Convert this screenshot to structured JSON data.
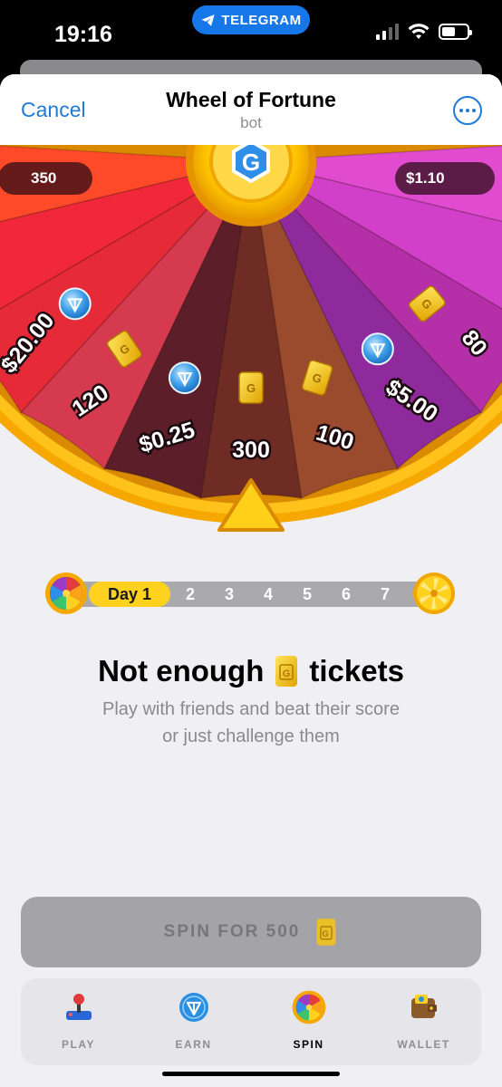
{
  "status_bar": {
    "time": "19:16",
    "pill_label": "TELEGRAM"
  },
  "nav": {
    "cancel_label": "Cancel",
    "title": "Wheel of Fortune",
    "subtitle": "bot",
    "more_icon": "more-dots-icon"
  },
  "wheel": {
    "center_logo": "G",
    "top_left_badge": "350",
    "top_right_badge": "$1.10",
    "segments": [
      {
        "label": "80",
        "reward": "ticket",
        "color": "#b42fa8"
      },
      {
        "label": "$5.00",
        "reward": "ton",
        "color": "#8f2a9c"
      },
      {
        "label": "100",
        "reward": "ticket",
        "color": "#9a4b2e"
      },
      {
        "label": "300",
        "reward": "ticket",
        "color": "#6e2c24"
      },
      {
        "label": "$0.25",
        "reward": "ton",
        "color": "#5c1f2a"
      },
      {
        "label": "120",
        "reward": "ticket",
        "color": "#d63a4f"
      },
      {
        "label": "$20.00",
        "reward": "ton",
        "color": "#e62a38"
      }
    ]
  },
  "streak": {
    "active_label": "Day 1",
    "days": [
      "2",
      "3",
      "4",
      "5",
      "6",
      "7"
    ]
  },
  "message": {
    "title_before": "Not enough",
    "title_after": "tickets",
    "line1": "Play with friends and beat their score",
    "line2": "or just challenge them"
  },
  "spin_button": {
    "label": "SPIN FOR 500"
  },
  "tabs": [
    {
      "label": "PLAY",
      "icon": "joystick-icon",
      "active": false
    },
    {
      "label": "EARN",
      "icon": "ton-coin-icon",
      "active": false
    },
    {
      "label": "SPIN",
      "icon": "fortune-wheel-icon",
      "active": true
    },
    {
      "label": "WALLET",
      "icon": "wallet-icon",
      "active": false
    }
  ],
  "colors": {
    "accent_blue": "#1f7ad8",
    "wheel_rim": "#ffb800",
    "streak_active": "#ffd21f",
    "ton_blue": "#2a8fe0"
  }
}
